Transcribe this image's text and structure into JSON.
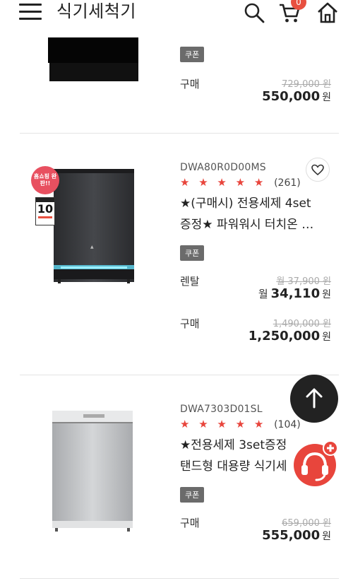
{
  "header": {
    "title": "식기세척기",
    "cart_count": "0",
    "icons": [
      "menu-icon",
      "search-icon",
      "cart-icon",
      "home-icon"
    ]
  },
  "products": [
    {
      "coupon": "쿠폰",
      "prices": [
        {
          "type": "구매",
          "original": "729,000 원",
          "sale": "550,000",
          "unit": "원"
        }
      ]
    },
    {
      "model": "DWA80R0D00MS",
      "stars": "★ ★ ★ ★ ★",
      "reviews": "(261)",
      "name_line1": "★(구매시) 전용세제 4set",
      "name_line2": "증정★ 파워워시 터치온 …",
      "coupon": "쿠폰",
      "badge_text": "홈쇼핑 완판!!",
      "prices": [
        {
          "type": "렌탈",
          "original": "월 37,900 원",
          "prefix": "월",
          "sale": "34,110",
          "unit": "원"
        },
        {
          "type": "구매",
          "original": "1,490,000 원",
          "sale": "1,250,000",
          "unit": "원"
        }
      ]
    },
    {
      "model": "DWA7303D01SL",
      "stars": "★ ★ ★ ★ ★",
      "reviews": "(104)",
      "name_line1": "★전용세제 3set증정",
      "name_line2": "탠드형 대용량 식기세",
      "coupon": "쿠폰",
      "prices": [
        {
          "type": "구매",
          "original": "659,000 원",
          "sale": "555,000",
          "unit": "원"
        }
      ]
    }
  ],
  "colors": {
    "accent": "#e8453c",
    "coupon_bg": "#6b6b6b",
    "badge": "#e85040"
  }
}
